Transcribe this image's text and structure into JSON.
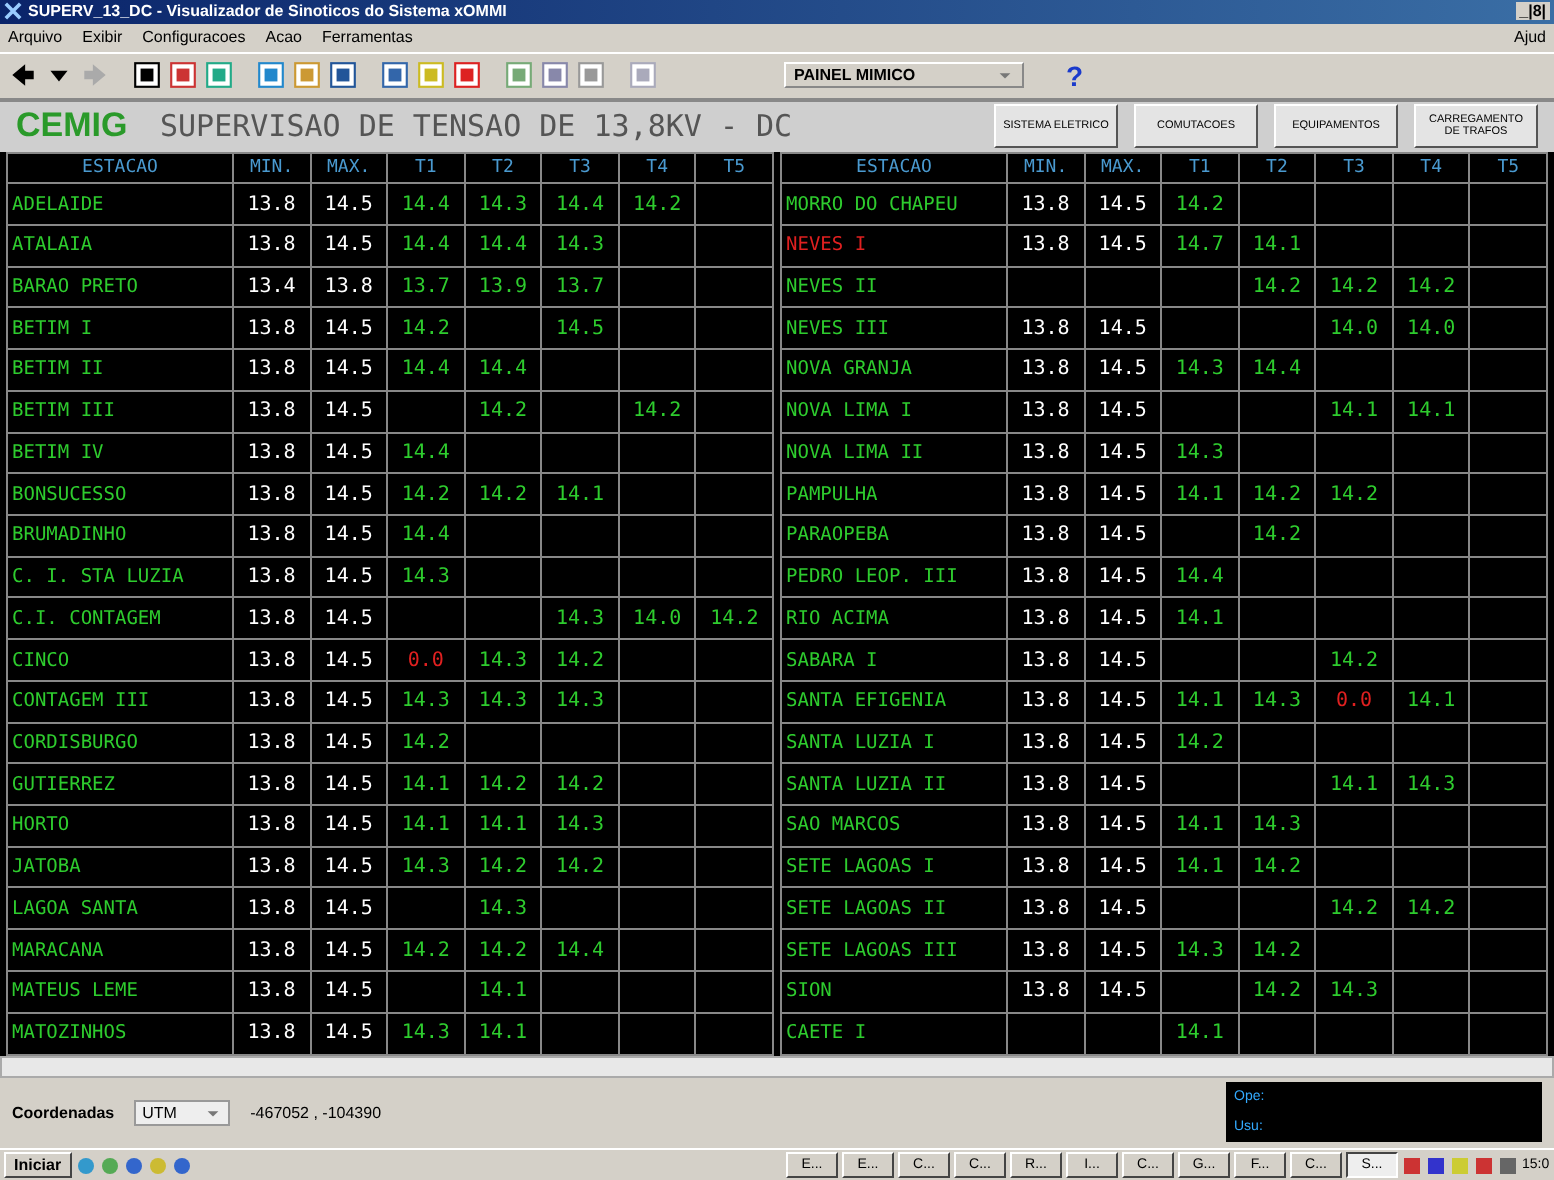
{
  "window": {
    "title": "SUPERV_13_DC - Visualizador de Sinoticos do Sistema xOMMI",
    "controls": "_|8|"
  },
  "menu": [
    {
      "label": "Arquivo"
    },
    {
      "label": "Exibir"
    },
    {
      "label": "Configuracoes"
    },
    {
      "label": "Acao"
    },
    {
      "label": "Ferramentas"
    }
  ],
  "menu_right": "Ajud",
  "toolbar": {
    "panel_select": "PAINEL MIMICO",
    "help": "?"
  },
  "banner": {
    "logo": "CEMIG",
    "title": "SUPERVISAO DE TENSAO DE 13,8KV - DC",
    "buttons": [
      {
        "label": "SISTEMA ELETRICO"
      },
      {
        "label": "COMUTACOES"
      },
      {
        "label": "EQUIPAMENTOS"
      },
      {
        "label": "CARREGAMENTO DE TRAFOS"
      }
    ]
  },
  "tables": [
    {
      "columns": [
        "ESTACAO",
        "MIN.",
        "MAX.",
        "T1",
        "T2",
        "T3",
        "T4",
        "T5"
      ],
      "rows": [
        {
          "station": "ADELAIDE",
          "alarm": false,
          "min": "13.8",
          "max": "14.5",
          "t": {
            "t1": {
              "value": "14.4",
              "alarm": false
            },
            "t2": {
              "value": "14.3",
              "alarm": false
            },
            "t3": {
              "value": "14.4",
              "alarm": false
            },
            "t4": {
              "value": "14.2",
              "alarm": false
            }
          }
        },
        {
          "station": "ATALAIA",
          "alarm": false,
          "min": "13.8",
          "max": "14.5",
          "t": {
            "t1": {
              "value": "14.4",
              "alarm": false
            },
            "t2": {
              "value": "14.4",
              "alarm": false
            },
            "t3": {
              "value": "14.3",
              "alarm": false
            }
          }
        },
        {
          "station": "BARAO PRETO",
          "alarm": false,
          "min": "13.4",
          "max": "13.8",
          "t": {
            "t1": {
              "value": "13.7",
              "alarm": false
            },
            "t2": {
              "value": "13.9",
              "alarm": false
            },
            "t3": {
              "value": "13.7",
              "alarm": false
            }
          }
        },
        {
          "station": "BETIM I",
          "alarm": false,
          "min": "13.8",
          "max": "14.5",
          "t": {
            "t1": {
              "value": "14.2",
              "alarm": false
            },
            "t3": {
              "value": "14.5",
              "alarm": false
            }
          }
        },
        {
          "station": "BETIM II",
          "alarm": false,
          "min": "13.8",
          "max": "14.5",
          "t": {
            "t1": {
              "value": "14.4",
              "alarm": false
            },
            "t2": {
              "value": "14.4",
              "alarm": false
            }
          }
        },
        {
          "station": "BETIM III",
          "alarm": false,
          "min": "13.8",
          "max": "14.5",
          "t": {
            "t2": {
              "value": "14.2",
              "alarm": false
            },
            "t4": {
              "value": "14.2",
              "alarm": false
            }
          }
        },
        {
          "station": "BETIM IV",
          "alarm": false,
          "min": "13.8",
          "max": "14.5",
          "t": {
            "t1": {
              "value": "14.4",
              "alarm": false
            }
          }
        },
        {
          "station": "BONSUCESSO",
          "alarm": false,
          "min": "13.8",
          "max": "14.5",
          "t": {
            "t1": {
              "value": "14.2",
              "alarm": false
            },
            "t2": {
              "value": "14.2",
              "alarm": false
            },
            "t3": {
              "value": "14.1",
              "alarm": false
            }
          }
        },
        {
          "station": "BRUMADINHO",
          "alarm": false,
          "min": "13.8",
          "max": "14.5",
          "t": {
            "t1": {
              "value": "14.4",
              "alarm": false
            }
          }
        },
        {
          "station": "C. I. STA LUZIA",
          "alarm": false,
          "min": "13.8",
          "max": "14.5",
          "t": {
            "t1": {
              "value": "14.3",
              "alarm": false
            }
          }
        },
        {
          "station": "C.I. CONTAGEM",
          "alarm": false,
          "min": "13.8",
          "max": "14.5",
          "t": {
            "t3": {
              "value": "14.3",
              "alarm": false
            },
            "t4": {
              "value": "14.0",
              "alarm": false
            },
            "t5": {
              "value": "14.2",
              "alarm": false
            }
          }
        },
        {
          "station": "CINCO",
          "alarm": false,
          "min": "13.8",
          "max": "14.5",
          "t": {
            "t1": {
              "value": "0.0",
              "alarm": true
            },
            "t2": {
              "value": "14.3",
              "alarm": false
            },
            "t3": {
              "value": "14.2",
              "alarm": false
            }
          }
        },
        {
          "station": "CONTAGEM III",
          "alarm": false,
          "min": "13.8",
          "max": "14.5",
          "t": {
            "t1": {
              "value": "14.3",
              "alarm": false
            },
            "t2": {
              "value": "14.3",
              "alarm": false
            },
            "t3": {
              "value": "14.3",
              "alarm": false
            }
          }
        },
        {
          "station": "CORDISBURGO",
          "alarm": false,
          "min": "13.8",
          "max": "14.5",
          "t": {
            "t1": {
              "value": "14.2",
              "alarm": false
            }
          }
        },
        {
          "station": "GUTIERREZ",
          "alarm": false,
          "min": "13.8",
          "max": "14.5",
          "t": {
            "t1": {
              "value": "14.1",
              "alarm": false
            },
            "t2": {
              "value": "14.2",
              "alarm": false
            },
            "t3": {
              "value": "14.2",
              "alarm": false
            }
          }
        },
        {
          "station": "HORTO",
          "alarm": false,
          "min": "13.8",
          "max": "14.5",
          "t": {
            "t1": {
              "value": "14.1",
              "alarm": false
            },
            "t2": {
              "value": "14.1",
              "alarm": false
            },
            "t3": {
              "value": "14.3",
              "alarm": false
            }
          }
        },
        {
          "station": "JATOBA",
          "alarm": false,
          "min": "13.8",
          "max": "14.5",
          "t": {
            "t1": {
              "value": "14.3",
              "alarm": false
            },
            "t2": {
              "value": "14.2",
              "alarm": false
            },
            "t3": {
              "value": "14.2",
              "alarm": false
            }
          }
        },
        {
          "station": "LAGOA SANTA",
          "alarm": false,
          "min": "13.8",
          "max": "14.5",
          "t": {
            "t2": {
              "value": "14.3",
              "alarm": false
            }
          }
        },
        {
          "station": "MARACANA",
          "alarm": false,
          "min": "13.8",
          "max": "14.5",
          "t": {
            "t1": {
              "value": "14.2",
              "alarm": false
            },
            "t2": {
              "value": "14.2",
              "alarm": false
            },
            "t3": {
              "value": "14.4",
              "alarm": false
            }
          }
        },
        {
          "station": "MATEUS LEME",
          "alarm": false,
          "min": "13.8",
          "max": "14.5",
          "t": {
            "t2": {
              "value": "14.1",
              "alarm": false
            }
          }
        },
        {
          "station": "MATOZINHOS",
          "alarm": false,
          "min": "13.8",
          "max": "14.5",
          "t": {
            "t1": {
              "value": "14.3",
              "alarm": false
            },
            "t2": {
              "value": "14.1",
              "alarm": false
            }
          }
        }
      ]
    },
    {
      "columns": [
        "ESTACAO",
        "MIN.",
        "MAX.",
        "T1",
        "T2",
        "T3",
        "T4",
        "T5"
      ],
      "rows": [
        {
          "station": "MORRO DO CHAPEU",
          "alarm": false,
          "min": "13.8",
          "max": "14.5",
          "t": {
            "t1": {
              "value": "14.2",
              "alarm": false
            }
          }
        },
        {
          "station": "NEVES I",
          "alarm": true,
          "min": "13.8",
          "max": "14.5",
          "t": {
            "t1": {
              "value": "14.7",
              "alarm": false
            },
            "t2": {
              "value": "14.1",
              "alarm": false
            }
          }
        },
        {
          "station": "NEVES II",
          "alarm": false,
          "t": {
            "t2": {
              "value": "14.2",
              "alarm": false
            },
            "t3": {
              "value": "14.2",
              "alarm": false
            },
            "t4": {
              "value": "14.2",
              "alarm": false
            }
          }
        },
        {
          "station": "NEVES III",
          "alarm": false,
          "min": "13.8",
          "max": "14.5",
          "t": {
            "t3": {
              "value": "14.0",
              "alarm": false
            },
            "t4": {
              "value": "14.0",
              "alarm": false
            }
          }
        },
        {
          "station": "NOVA GRANJA",
          "alarm": false,
          "min": "13.8",
          "max": "14.5",
          "t": {
            "t1": {
              "value": "14.3",
              "alarm": false
            },
            "t2": {
              "value": "14.4",
              "alarm": false
            }
          }
        },
        {
          "station": "NOVA LIMA I",
          "alarm": false,
          "min": "13.8",
          "max": "14.5",
          "t": {
            "t3": {
              "value": "14.1",
              "alarm": false
            },
            "t4": {
              "value": "14.1",
              "alarm": false
            }
          }
        },
        {
          "station": "NOVA LIMA II",
          "alarm": false,
          "min": "13.8",
          "max": "14.5",
          "t": {
            "t1": {
              "value": "14.3",
              "alarm": false
            }
          }
        },
        {
          "station": "PAMPULHA",
          "alarm": false,
          "min": "13.8",
          "max": "14.5",
          "t": {
            "t1": {
              "value": "14.1",
              "alarm": false
            },
            "t2": {
              "value": "14.2",
              "alarm": false
            },
            "t3": {
              "value": "14.2",
              "alarm": false
            }
          }
        },
        {
          "station": "PARAOPEBA",
          "alarm": false,
          "min": "13.8",
          "max": "14.5",
          "t": {
            "t2": {
              "value": "14.2",
              "alarm": false
            }
          }
        },
        {
          "station": "PEDRO LEOP. III",
          "alarm": false,
          "min": "13.8",
          "max": "14.5",
          "t": {
            "t1": {
              "value": "14.4",
              "alarm": false
            }
          }
        },
        {
          "station": "RIO ACIMA",
          "alarm": false,
          "min": "13.8",
          "max": "14.5",
          "t": {
            "t1": {
              "value": "14.1",
              "alarm": false
            }
          }
        },
        {
          "station": "SABARA I",
          "alarm": false,
          "min": "13.8",
          "max": "14.5",
          "t": {
            "t3": {
              "value": "14.2",
              "alarm": false
            }
          }
        },
        {
          "station": "SANTA EFIGENIA",
          "alarm": false,
          "min": "13.8",
          "max": "14.5",
          "t": {
            "t1": {
              "value": "14.1",
              "alarm": false
            },
            "t2": {
              "value": "14.3",
              "alarm": false
            },
            "t3": {
              "value": "0.0",
              "alarm": true
            },
            "t4": {
              "value": "14.1",
              "alarm": false
            }
          }
        },
        {
          "station": "SANTA LUZIA I",
          "alarm": false,
          "min": "13.8",
          "max": "14.5",
          "t": {
            "t1": {
              "value": "14.2",
              "alarm": false
            }
          }
        },
        {
          "station": "SANTA LUZIA II",
          "alarm": false,
          "min": "13.8",
          "max": "14.5",
          "t": {
            "t3": {
              "value": "14.1",
              "alarm": false
            },
            "t4": {
              "value": "14.3",
              "alarm": false
            }
          }
        },
        {
          "station": "SAO MARCOS",
          "alarm": false,
          "min": "13.8",
          "max": "14.5",
          "t": {
            "t1": {
              "value": "14.1",
              "alarm": false
            },
            "t2": {
              "value": "14.3",
              "alarm": false
            }
          }
        },
        {
          "station": "SETE LAGOAS I",
          "alarm": false,
          "min": "13.8",
          "max": "14.5",
          "t": {
            "t1": {
              "value": "14.1",
              "alarm": false
            },
            "t2": {
              "value": "14.2",
              "alarm": false
            }
          }
        },
        {
          "station": "SETE LAGOAS II",
          "alarm": false,
          "min": "13.8",
          "max": "14.5",
          "t": {
            "t3": {
              "value": "14.2",
              "alarm": false
            },
            "t4": {
              "value": "14.2",
              "alarm": false
            }
          }
        },
        {
          "station": "SETE LAGOAS III",
          "alarm": false,
          "min": "13.8",
          "max": "14.5",
          "t": {
            "t1": {
              "value": "14.3",
              "alarm": false
            },
            "t2": {
              "value": "14.2",
              "alarm": false
            }
          }
        },
        {
          "station": "SION",
          "alarm": false,
          "min": "13.8",
          "max": "14.5",
          "t": {
            "t2": {
              "value": "14.2",
              "alarm": false
            },
            "t3": {
              "value": "14.3",
              "alarm": false
            }
          }
        },
        {
          "station": "CAETE I",
          "alarm": false,
          "t": {
            "t1": {
              "value": "14.1",
              "alarm": false
            }
          }
        }
      ]
    }
  ],
  "status": {
    "coord_label": "Coordenadas",
    "coord_system": "UTM",
    "coords": "-467052 , -104390",
    "operator_label": "Ope:",
    "user_label": "Usu:"
  },
  "taskbar": {
    "start": "Iniciar",
    "tasks": [
      {
        "label": "E...",
        "selected": false
      },
      {
        "label": "E...",
        "selected": false
      },
      {
        "label": "C...",
        "selected": false
      },
      {
        "label": "C...",
        "selected": false
      },
      {
        "label": "R...",
        "selected": false
      },
      {
        "label": "I...",
        "selected": false
      },
      {
        "label": "C...",
        "selected": false
      },
      {
        "label": "G...",
        "selected": false
      },
      {
        "label": "F...",
        "selected": false
      },
      {
        "label": "C...",
        "selected": false
      },
      {
        "label": "S...",
        "selected": true
      }
    ],
    "clock": "15:0"
  }
}
